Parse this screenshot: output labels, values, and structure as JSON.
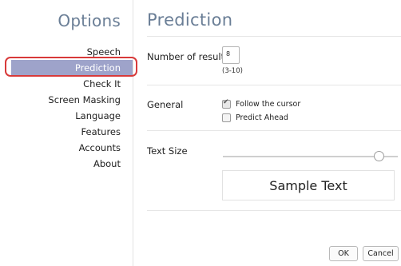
{
  "sidebar": {
    "title": "Options",
    "items": [
      {
        "label": "Speech"
      },
      {
        "label": "Prediction"
      },
      {
        "label": "Check It"
      },
      {
        "label": "Screen Masking"
      },
      {
        "label": "Language"
      },
      {
        "label": "Features"
      },
      {
        "label": "Accounts"
      },
      {
        "label": "About"
      }
    ],
    "selected": "Prediction"
  },
  "main": {
    "title": "Prediction",
    "number_of_results": {
      "label": "Number of results",
      "value": "8",
      "hint": "(3-10)"
    },
    "general": {
      "label": "General",
      "follow_cursor": {
        "label": "Follow the cursor",
        "checked": true
      },
      "predict_ahead": {
        "label": "Predict Ahead",
        "checked": false
      }
    },
    "text_size": {
      "label": "Text Size",
      "slider_level_fraction": 0.9,
      "sample": "Sample Text"
    }
  },
  "buttons": {
    "ok": "OK",
    "cancel": "Cancel"
  },
  "colors": {
    "accent_title": "#6a7e96",
    "selected_bg": "#9ea3ca",
    "highlight_ring": "#d83a3a"
  }
}
